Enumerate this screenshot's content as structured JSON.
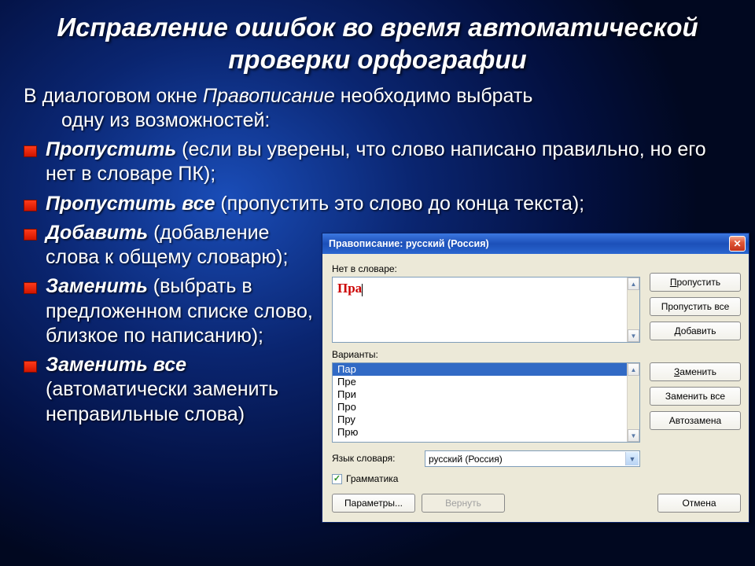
{
  "slide": {
    "title": "Исправление ошибок во время автоматической проверки орфографии",
    "intro_before": "В диалоговом окне",
    "intro_ital": "Правописание",
    "intro_after": "необходимо выбрать",
    "intro_line2": "одну из возможностей:",
    "b1_term": "Пропустить",
    "b1_rest": " (если вы уверены, что слово написано правильно, но его нет в словаре ПК);",
    "b2_term": "Пропустить все",
    "b2_rest": "  (пропустить это слово до конца текста);",
    "b3_term": "Добавить",
    "b3_rest": "  (добавление слова к общему словарю);",
    "b4_term": "Заменить",
    "b4_rest": "  (выбрать в предложенном списке слово, близкое по написанию);",
    "b5_term": "Заменить все",
    "b5_rest": " (автоматически заменить неправильные слова)"
  },
  "dialog": {
    "title": "Правописание: русский (Россия)",
    "not_in_dict_label": "Нет в словаре:",
    "word": "Пра",
    "variants_label": "Варианты:",
    "variants": [
      "Пар",
      "Пре",
      "При",
      "Про",
      "Пру",
      "Прю"
    ],
    "lang_label": "Язык словаря:",
    "lang_value": "русский (Россия)",
    "grammar_label": "Грамматика",
    "buttons": {
      "skip": "Пропустить",
      "skip_all": "Пропустить все",
      "add": "Добавить",
      "replace": "Заменить",
      "replace_all": "Заменить все",
      "autocorrect": "Автозамена",
      "options": "Параметры...",
      "revert": "Вернуть",
      "cancel": "Отмена"
    }
  }
}
